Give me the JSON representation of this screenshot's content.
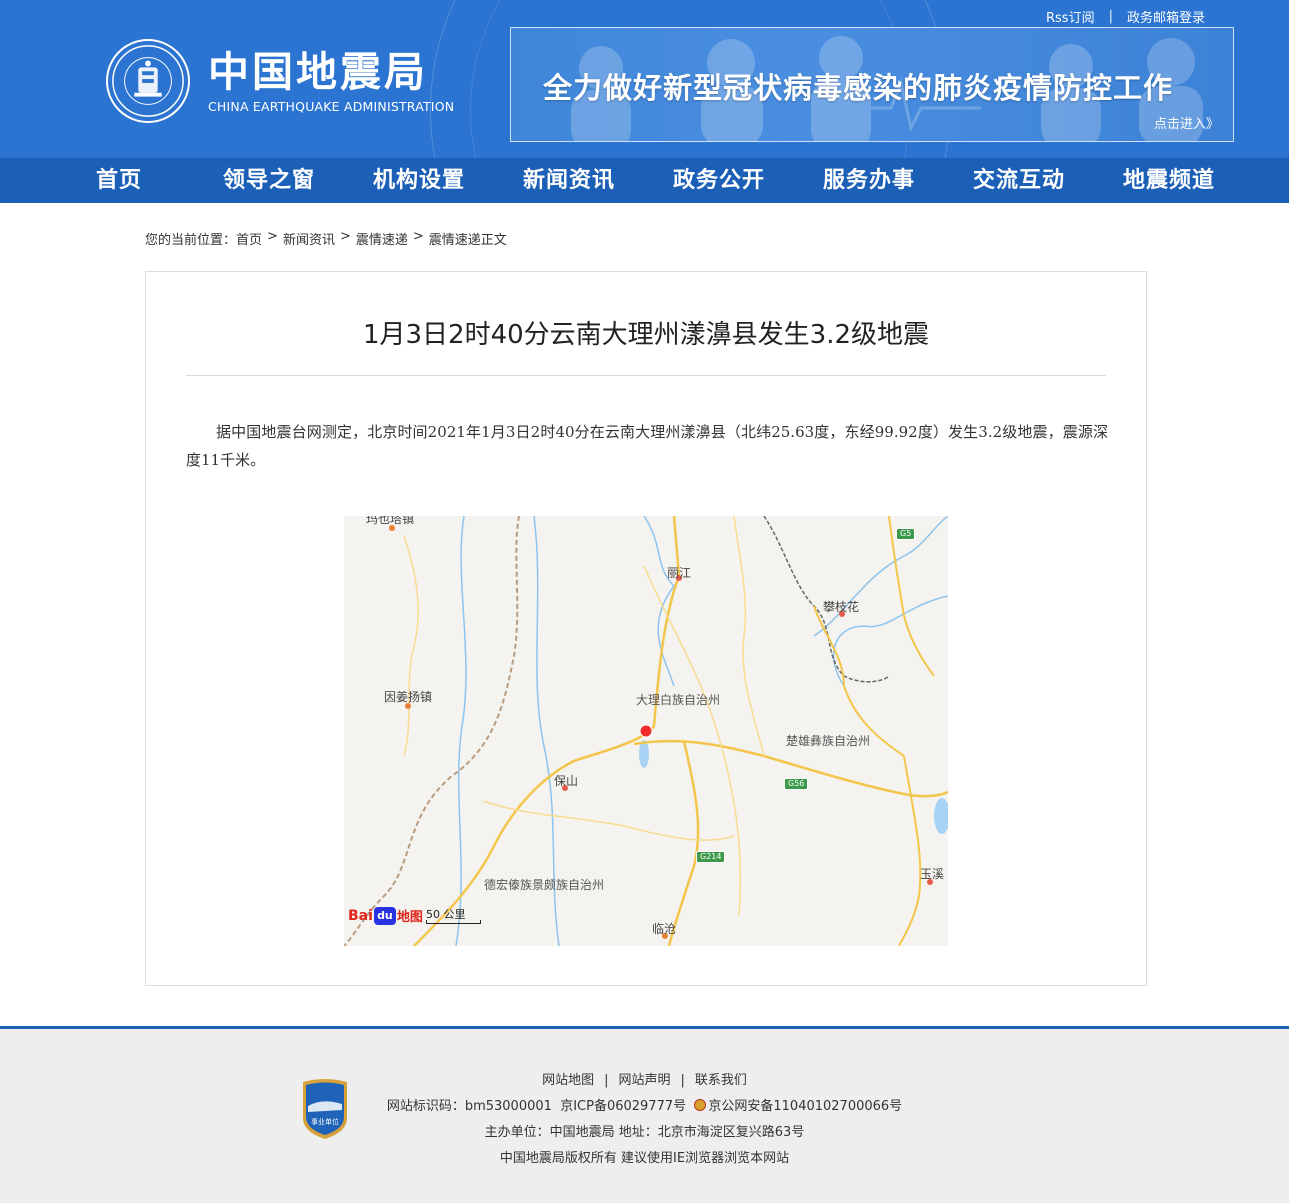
{
  "header": {
    "rss": "Rss订阅",
    "mail_login": "政务邮箱登录",
    "logo_cn": "中国地震局",
    "logo_en": "CHINA EARTHQUAKE ADMINISTRATION",
    "banner_slogan": "全力做好新型冠状病毒感染的肺炎疫情防控工作",
    "banner_enter": "点击进入》"
  },
  "nav": {
    "items": [
      "首页",
      "领导之窗",
      "机构设置",
      "新闻资讯",
      "政务公开",
      "服务办事",
      "交流互动",
      "地震频道"
    ]
  },
  "breadcrumb": {
    "prefix": "您的当前位置：",
    "items": [
      "首页",
      "新闻资讯",
      "震情速递",
      "震情速递正文"
    ]
  },
  "article": {
    "title": "1月3日2时40分云南大理州漾濞县发生3.2级地震",
    "body": "据中国地震台网测定，北京时间2021年1月3日2时40分在云南大理州漾濞县（北纬25.63度，东经99.92度）发生3.2级地震，震源深度11千米。"
  },
  "map": {
    "labels": {
      "top_town": "玛也塔镇",
      "lijiang": "丽江",
      "panzhihua": "攀枝花",
      "yinjiang": "因姜扬镇",
      "dali": "大理白族自治州",
      "chuxiong": "楚雄彝族自治州",
      "baoshan": "保山",
      "dehong": "德宏傣族景颇族自治州",
      "yuxi": "玉溪",
      "lincang": "临沧"
    },
    "shields": {
      "g5": "G5",
      "g56": "G56",
      "g214": "G214"
    },
    "logo": {
      "bai": "Bai",
      "du": "du",
      "ditu": "地图"
    },
    "scale": "50 公里",
    "epicenter_color": "#f02b2b"
  },
  "footer": {
    "links": [
      "网站地图",
      "网站声明",
      "联系我们"
    ],
    "line2_id": "网站标识码：bm53000001",
    "line2_icp": "京ICP备06029777号",
    "line2_police": "京公网安备11040102700066号",
    "line3": "主办单位：中国地震局   地址：北京市海淀区复兴路63号",
    "line4": "中国地震局版权所有   建议使用IE浏览器浏览本网站",
    "badge": "事业单位"
  }
}
